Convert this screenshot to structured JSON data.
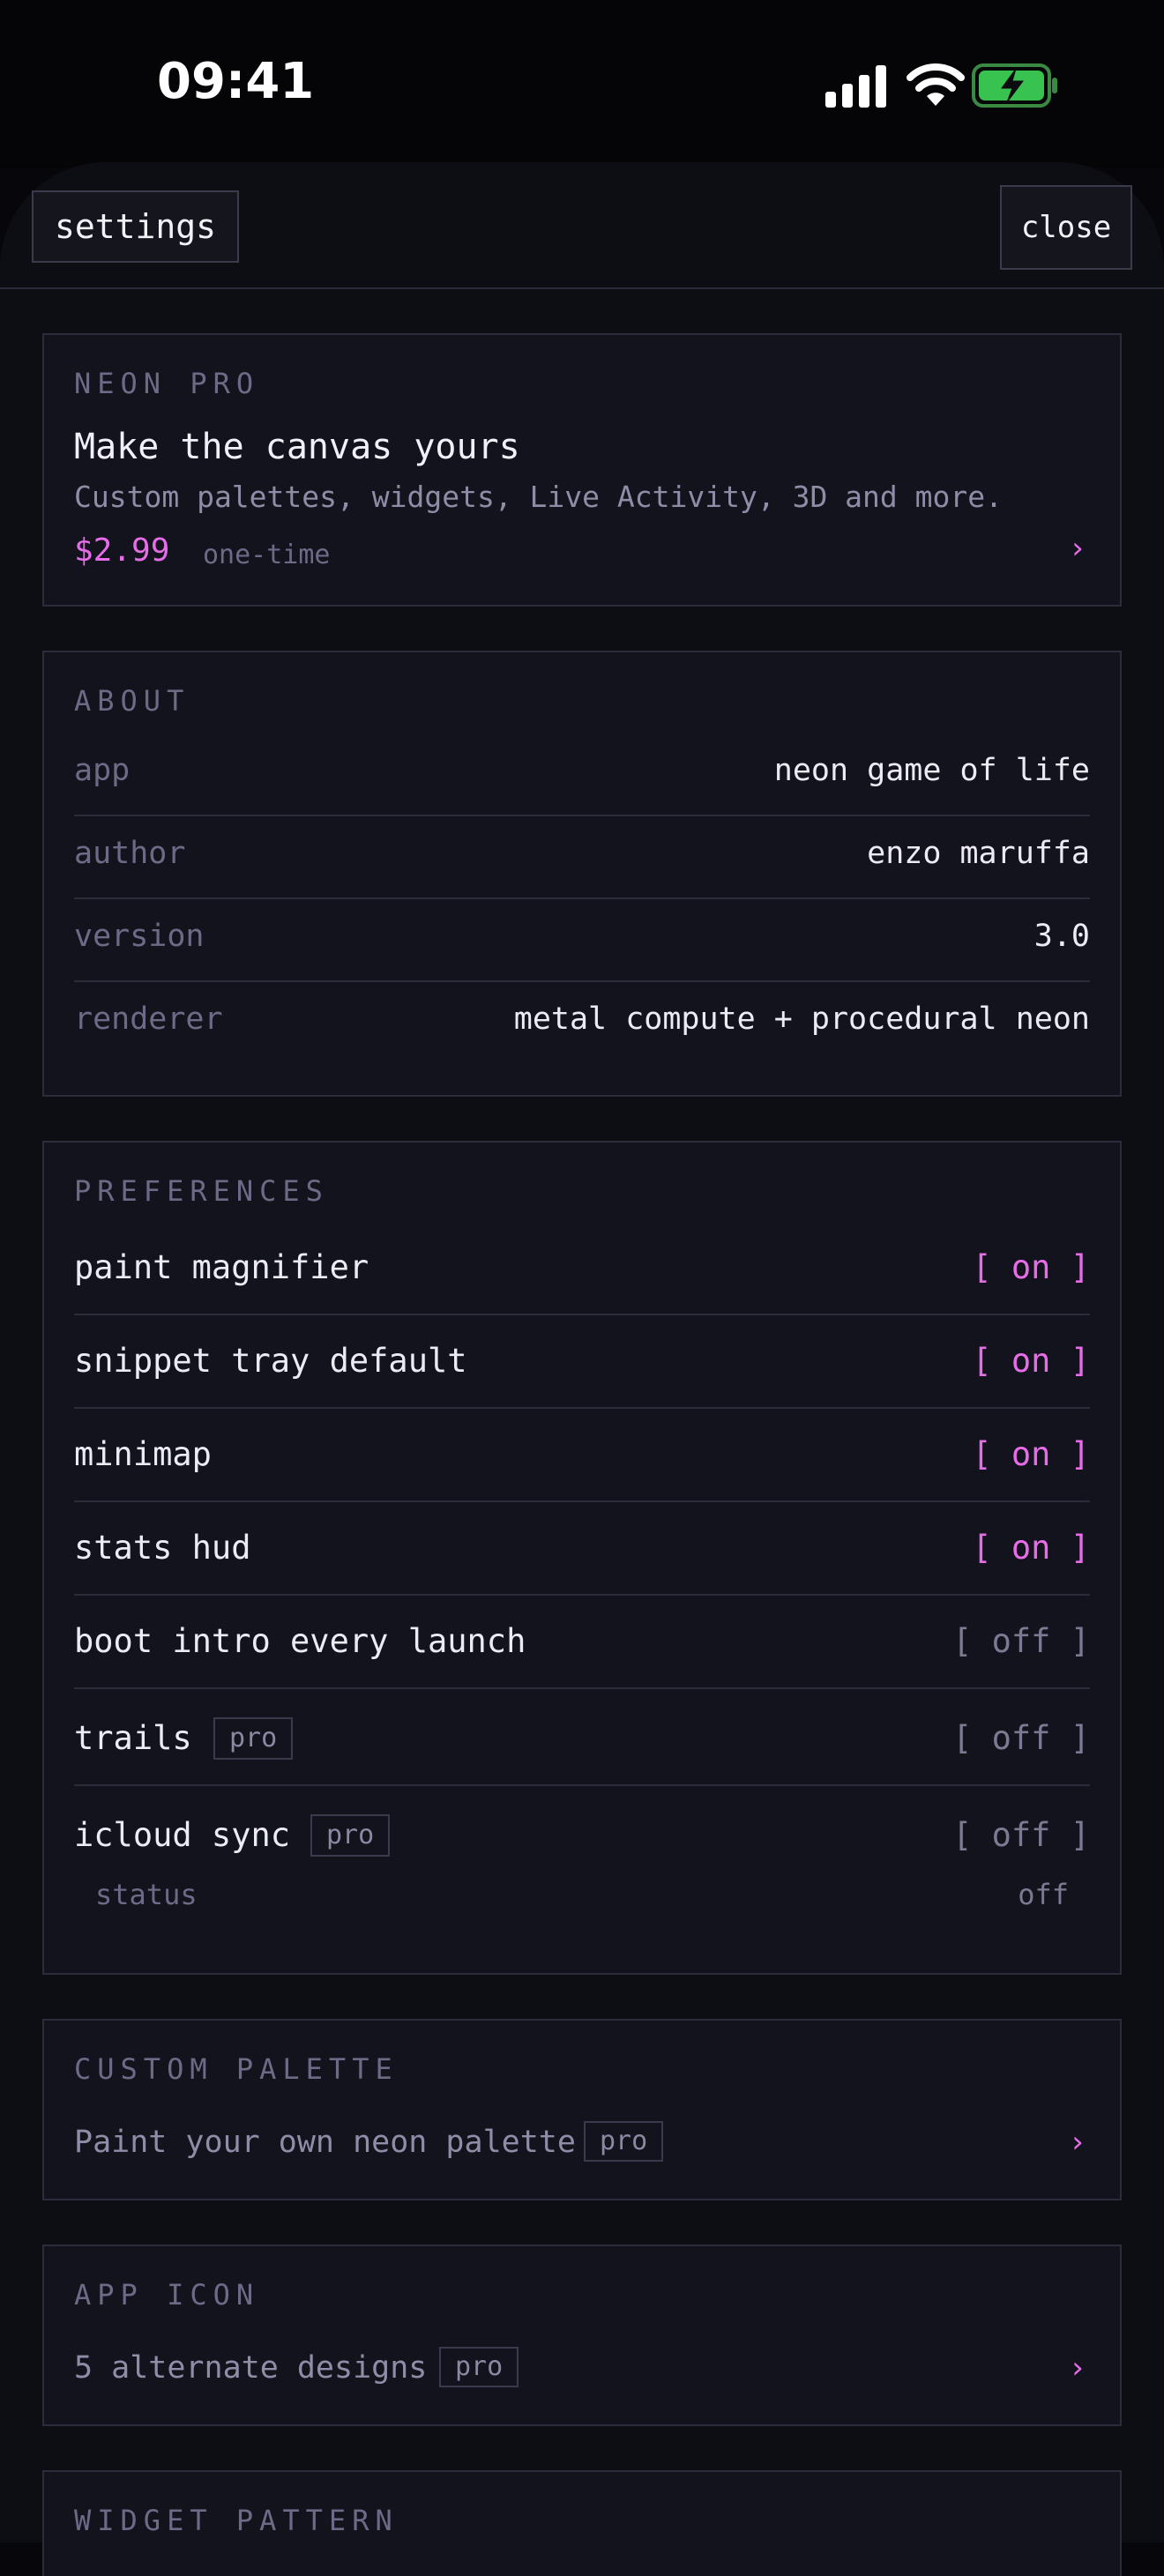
{
  "status_bar": {
    "time": "09:41"
  },
  "header": {
    "title": "settings",
    "close_label": "close"
  },
  "neon_pro": {
    "heading": "NEON PRO",
    "title": "Make the canvas yours",
    "description": "Custom palettes, widgets, Live Activity, 3D and more.",
    "price": "$2.99",
    "price_note": "one-time",
    "chevron": "›"
  },
  "about": {
    "heading": "ABOUT",
    "rows": [
      {
        "key": "app",
        "value": "neon game of life"
      },
      {
        "key": "author",
        "value": "enzo maruffa"
      },
      {
        "key": "version",
        "value": "3.0"
      },
      {
        "key": "renderer",
        "value": "metal compute + procedural neon"
      }
    ]
  },
  "preferences": {
    "heading": "PREFERENCES",
    "pro_badge": "pro",
    "rows": [
      {
        "label": "paint magnifier",
        "toggle": "[ on ]"
      },
      {
        "label": "snippet tray default",
        "toggle": "[ on ]"
      },
      {
        "label": "minimap",
        "toggle": "[ on ]"
      },
      {
        "label": "stats hud",
        "toggle": "[ on ]"
      },
      {
        "label": "boot intro every launch",
        "toggle": "[ off ]"
      },
      {
        "label": "trails",
        "toggle": "[ off ]"
      },
      {
        "label": "icloud sync",
        "toggle": "[ off ]"
      }
    ],
    "sync_status_label": "status",
    "sync_status_value": "off"
  },
  "custom_palette": {
    "heading": "CUSTOM PALETTE",
    "text": "Paint your own neon palette",
    "badge": "pro",
    "chevron": "›"
  },
  "app_icon": {
    "heading": "APP ICON",
    "text": "5 alternate designs",
    "badge": "pro",
    "chevron": "›"
  },
  "widget_pattern": {
    "heading": "WIDGET PATTERN"
  },
  "colors": {
    "accent": "#e76ce8",
    "background": "#07070b",
    "card": "#13131d",
    "muted": "#6c6a86"
  }
}
